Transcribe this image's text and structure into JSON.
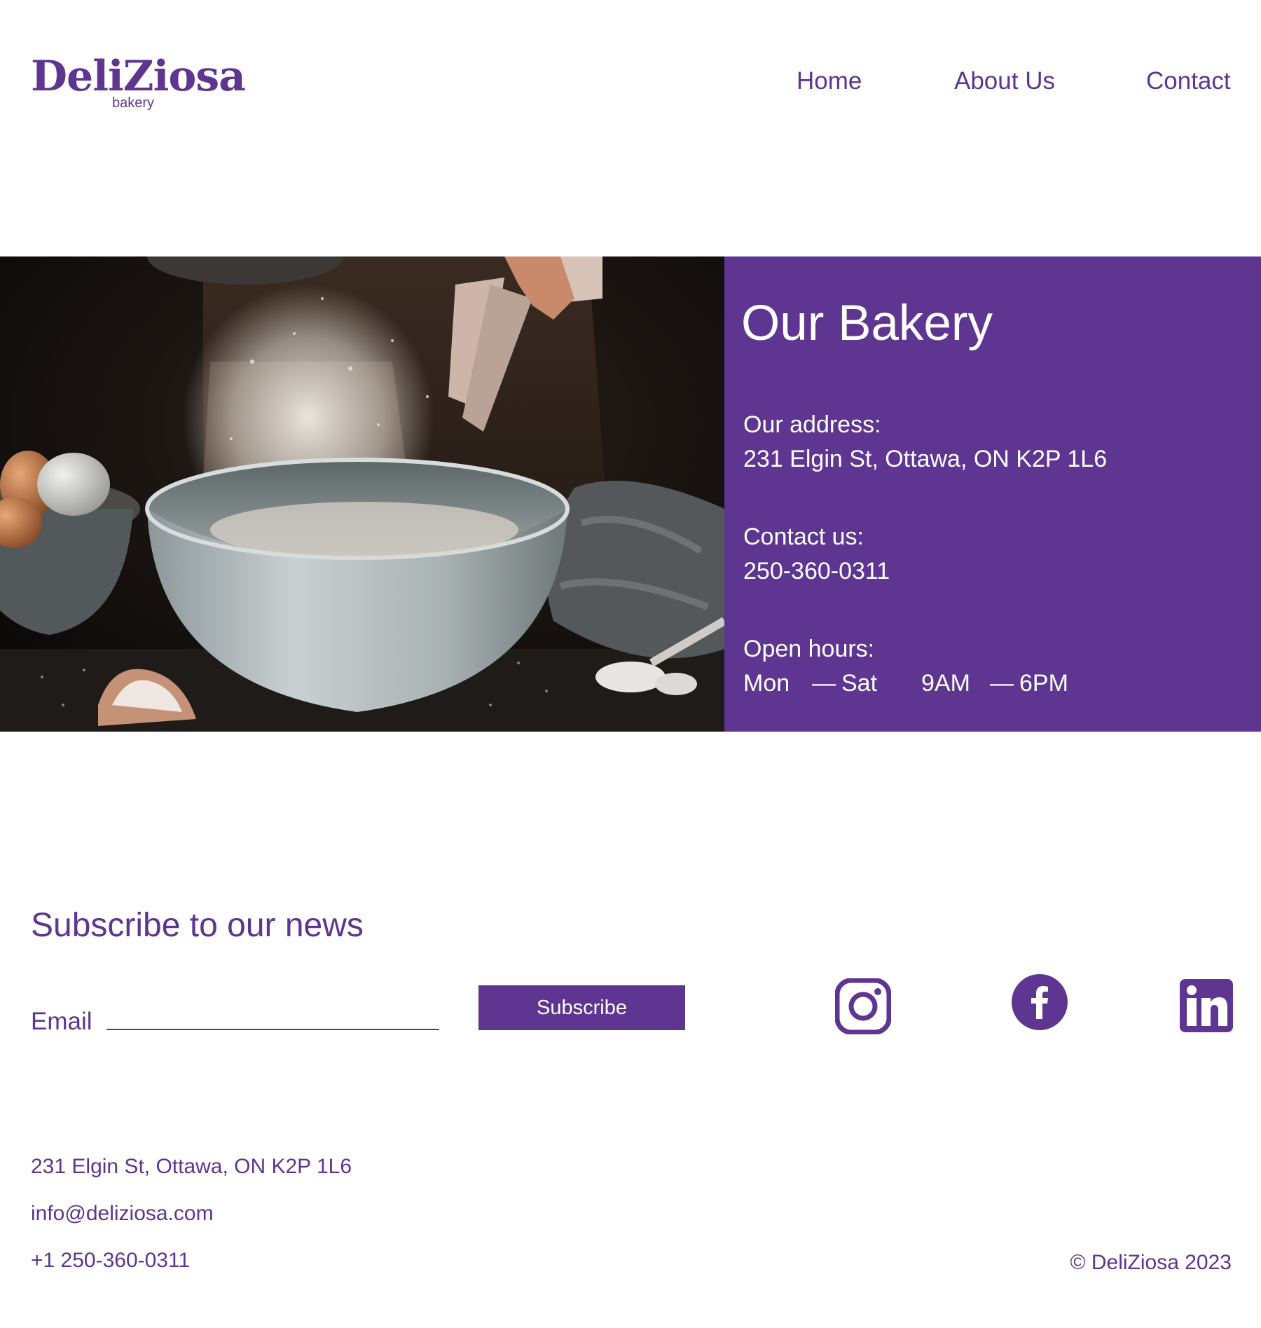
{
  "brand": {
    "name": "DeliZiosa",
    "tagline": "bakery"
  },
  "nav": {
    "items": [
      {
        "label": "Home"
      },
      {
        "label": "About Us"
      },
      {
        "label": "Contact"
      }
    ]
  },
  "hero": {
    "image_icon": "flour-sifting-photo",
    "panel": {
      "title": "Our Bakery",
      "address_label": "Our address:",
      "address": "231 Elgin St, Ottawa, ON K2P 1L6",
      "contact_label": "Contact us:",
      "phone": "250-360-0311",
      "hours_label": "Open hours:",
      "hours": {
        "day_start": "Mon",
        "day_end": "Sat",
        "open": "9AM",
        "close": "6PM",
        "separator": "—"
      }
    }
  },
  "subscribe": {
    "title": "Subscribe to our news",
    "email_label": "Email",
    "email_value": "",
    "button_label": "Subscribe"
  },
  "social": [
    {
      "icon": "instagram-icon"
    },
    {
      "icon": "facebook-icon"
    },
    {
      "icon": "linkedin-icon"
    }
  ],
  "footer": {
    "address": "231 Elgin St, Ottawa, ON K2P 1L6",
    "email": "info@deliziosa.com",
    "phone": "+1 250-360-0311",
    "copyright": "© DeliZiosa 2023"
  },
  "colors": {
    "brand_purple": "#5e3590",
    "background": "#ffffff",
    "panel_text": "#ffffff"
  }
}
